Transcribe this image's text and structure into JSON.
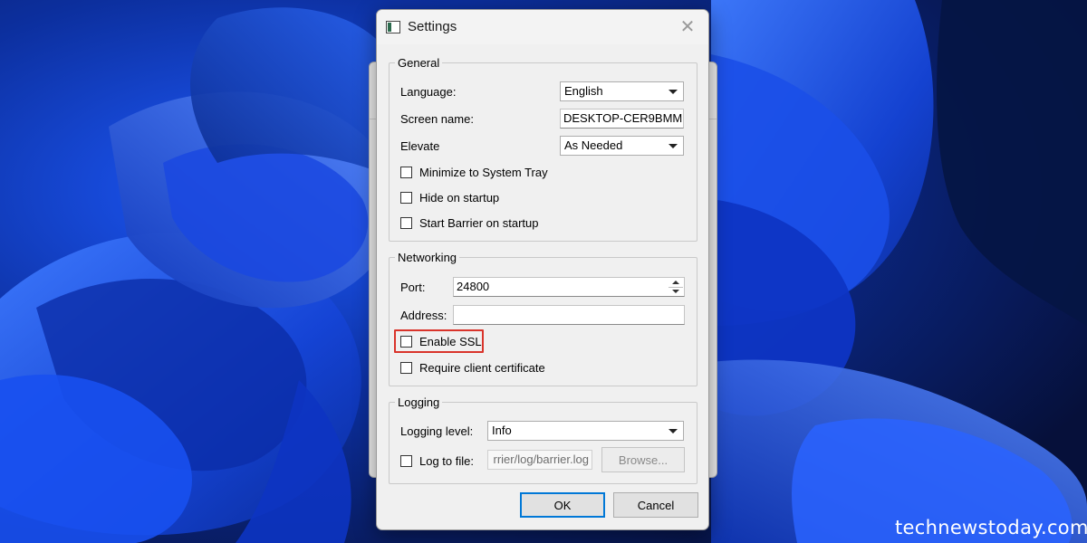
{
  "window": {
    "title": "Settings",
    "close_icon": "close-icon"
  },
  "general": {
    "legend": "General",
    "language_label": "Language:",
    "language_value": "English",
    "screen_name_label": "Screen name:",
    "screen_name_value": "DESKTOP-CER9BMM",
    "elevate_label": "Elevate",
    "elevate_value": "As Needed",
    "minimize_label": "Minimize to System Tray",
    "hide_label": "Hide on startup",
    "start_label": "Start Barrier on startup"
  },
  "networking": {
    "legend": "Networking",
    "port_label": "Port:",
    "port_value": "24800",
    "address_label": "Address:",
    "address_value": "",
    "ssl_label": "Enable SSL",
    "require_cert_label": "Require client certificate"
  },
  "logging": {
    "legend": "Logging",
    "level_label": "Logging level:",
    "level_value": "Info",
    "log_to_file_label": "Log to file:",
    "log_path_value": "rrier/log/barrier.log",
    "browse_label": "Browse..."
  },
  "buttons": {
    "ok_label": "OK",
    "cancel_label": "Cancel"
  },
  "watermark": "technewstoday.com",
  "colors": {
    "highlight": "#d9342b",
    "accent": "#0078d7"
  }
}
